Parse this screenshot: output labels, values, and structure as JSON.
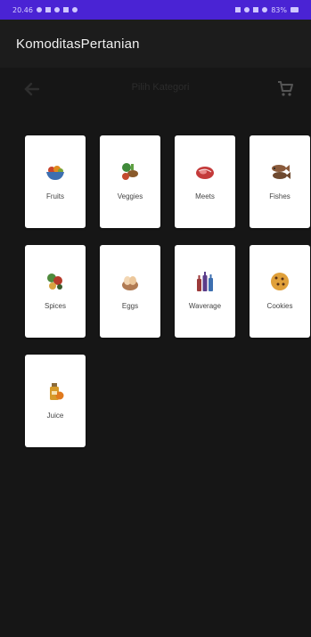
{
  "status_bar": {
    "time": "20.46",
    "battery": "83%"
  },
  "app_bar": {
    "title": "KomoditasPertanian"
  },
  "toolbar": {
    "back_icon": "arrow-back-icon",
    "title": "Pilih Kategori",
    "cart_icon": "shopping-cart-icon"
  },
  "categories": [
    {
      "label": "Fruits",
      "icon": "fruit-bowl-icon"
    },
    {
      "label": "Veggies",
      "icon": "vegetables-icon"
    },
    {
      "label": "Meets",
      "icon": "meat-icon"
    },
    {
      "label": "Fishes",
      "icon": "fish-icon"
    },
    {
      "label": "Spices",
      "icon": "spices-icon"
    },
    {
      "label": "Eggs",
      "icon": "eggs-icon"
    },
    {
      "label": "Waverage",
      "icon": "bottles-icon"
    },
    {
      "label": "Cookies",
      "icon": "cookie-icon"
    },
    {
      "label": "Juice",
      "icon": "juice-icon"
    }
  ],
  "colors": {
    "status_bar": "#4a23d4",
    "app_bar": "#1c1c1c",
    "background": "#161616",
    "card": "#ffffff"
  }
}
